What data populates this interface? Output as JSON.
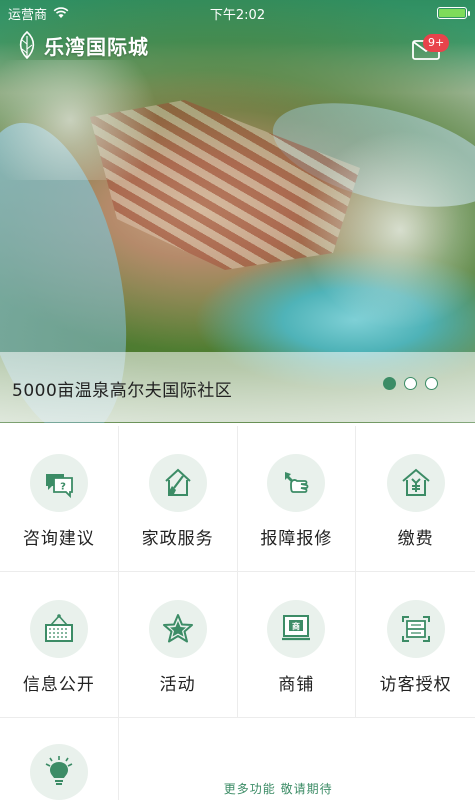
{
  "status_bar": {
    "carrier": "运营商",
    "time": "下午2:02",
    "battery_level": 1.0
  },
  "header": {
    "logo_text": "乐湾国际城",
    "mail_badge": "9+"
  },
  "banner": {
    "caption": "5000亩温泉高尔夫国际社区",
    "page_count": 3,
    "active_page": 1
  },
  "menu": {
    "items": [
      {
        "label": "咨询建议",
        "icon": "consult-icon"
      },
      {
        "label": "家政服务",
        "icon": "housekeeping-icon"
      },
      {
        "label": "报障报修",
        "icon": "repair-icon"
      },
      {
        "label": "缴费",
        "icon": "payment-icon"
      },
      {
        "label": "信息公开",
        "icon": "notice-board-icon"
      },
      {
        "label": "活动",
        "icon": "star-icon"
      },
      {
        "label": "商铺",
        "icon": "shop-icon"
      },
      {
        "label": "访客授权",
        "icon": "visitor-icon"
      }
    ],
    "more_icon": "lightbulb-icon",
    "coming_soon_text": "更多功能  敬请期待"
  },
  "colors": {
    "accent": "#3c8c66",
    "icon_bg": "#e9f1ec",
    "badge": "#e8434b"
  }
}
